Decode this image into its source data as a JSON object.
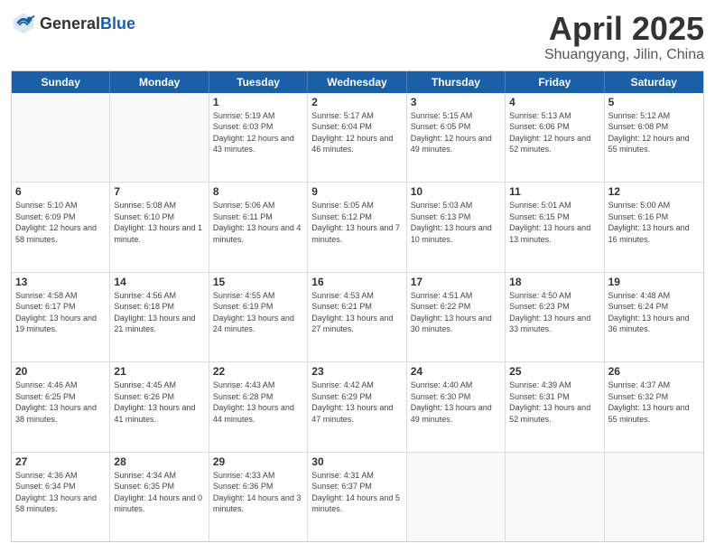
{
  "header": {
    "logo_general": "General",
    "logo_blue": "Blue",
    "title": "April 2025",
    "subtitle": "Shuangyang, Jilin, China"
  },
  "weekdays": [
    "Sunday",
    "Monday",
    "Tuesday",
    "Wednesday",
    "Thursday",
    "Friday",
    "Saturday"
  ],
  "weeks": [
    [
      {
        "day": "",
        "empty": true
      },
      {
        "day": "",
        "empty": true
      },
      {
        "day": "1",
        "sunrise": "Sunrise: 5:19 AM",
        "sunset": "Sunset: 6:03 PM",
        "daylight": "Daylight: 12 hours and 43 minutes."
      },
      {
        "day": "2",
        "sunrise": "Sunrise: 5:17 AM",
        "sunset": "Sunset: 6:04 PM",
        "daylight": "Daylight: 12 hours and 46 minutes."
      },
      {
        "day": "3",
        "sunrise": "Sunrise: 5:15 AM",
        "sunset": "Sunset: 6:05 PM",
        "daylight": "Daylight: 12 hours and 49 minutes."
      },
      {
        "day": "4",
        "sunrise": "Sunrise: 5:13 AM",
        "sunset": "Sunset: 6:06 PM",
        "daylight": "Daylight: 12 hours and 52 minutes."
      },
      {
        "day": "5",
        "sunrise": "Sunrise: 5:12 AM",
        "sunset": "Sunset: 6:08 PM",
        "daylight": "Daylight: 12 hours and 55 minutes."
      }
    ],
    [
      {
        "day": "6",
        "sunrise": "Sunrise: 5:10 AM",
        "sunset": "Sunset: 6:09 PM",
        "daylight": "Daylight: 12 hours and 58 minutes."
      },
      {
        "day": "7",
        "sunrise": "Sunrise: 5:08 AM",
        "sunset": "Sunset: 6:10 PM",
        "daylight": "Daylight: 13 hours and 1 minute."
      },
      {
        "day": "8",
        "sunrise": "Sunrise: 5:06 AM",
        "sunset": "Sunset: 6:11 PM",
        "daylight": "Daylight: 13 hours and 4 minutes."
      },
      {
        "day": "9",
        "sunrise": "Sunrise: 5:05 AM",
        "sunset": "Sunset: 6:12 PM",
        "daylight": "Daylight: 13 hours and 7 minutes."
      },
      {
        "day": "10",
        "sunrise": "Sunrise: 5:03 AM",
        "sunset": "Sunset: 6:13 PM",
        "daylight": "Daylight: 13 hours and 10 minutes."
      },
      {
        "day": "11",
        "sunrise": "Sunrise: 5:01 AM",
        "sunset": "Sunset: 6:15 PM",
        "daylight": "Daylight: 13 hours and 13 minutes."
      },
      {
        "day": "12",
        "sunrise": "Sunrise: 5:00 AM",
        "sunset": "Sunset: 6:16 PM",
        "daylight": "Daylight: 13 hours and 16 minutes."
      }
    ],
    [
      {
        "day": "13",
        "sunrise": "Sunrise: 4:58 AM",
        "sunset": "Sunset: 6:17 PM",
        "daylight": "Daylight: 13 hours and 19 minutes."
      },
      {
        "day": "14",
        "sunrise": "Sunrise: 4:56 AM",
        "sunset": "Sunset: 6:18 PM",
        "daylight": "Daylight: 13 hours and 21 minutes."
      },
      {
        "day": "15",
        "sunrise": "Sunrise: 4:55 AM",
        "sunset": "Sunset: 6:19 PM",
        "daylight": "Daylight: 13 hours and 24 minutes."
      },
      {
        "day": "16",
        "sunrise": "Sunrise: 4:53 AM",
        "sunset": "Sunset: 6:21 PM",
        "daylight": "Daylight: 13 hours and 27 minutes."
      },
      {
        "day": "17",
        "sunrise": "Sunrise: 4:51 AM",
        "sunset": "Sunset: 6:22 PM",
        "daylight": "Daylight: 13 hours and 30 minutes."
      },
      {
        "day": "18",
        "sunrise": "Sunrise: 4:50 AM",
        "sunset": "Sunset: 6:23 PM",
        "daylight": "Daylight: 13 hours and 33 minutes."
      },
      {
        "day": "19",
        "sunrise": "Sunrise: 4:48 AM",
        "sunset": "Sunset: 6:24 PM",
        "daylight": "Daylight: 13 hours and 36 minutes."
      }
    ],
    [
      {
        "day": "20",
        "sunrise": "Sunrise: 4:46 AM",
        "sunset": "Sunset: 6:25 PM",
        "daylight": "Daylight: 13 hours and 38 minutes."
      },
      {
        "day": "21",
        "sunrise": "Sunrise: 4:45 AM",
        "sunset": "Sunset: 6:26 PM",
        "daylight": "Daylight: 13 hours and 41 minutes."
      },
      {
        "day": "22",
        "sunrise": "Sunrise: 4:43 AM",
        "sunset": "Sunset: 6:28 PM",
        "daylight": "Daylight: 13 hours and 44 minutes."
      },
      {
        "day": "23",
        "sunrise": "Sunrise: 4:42 AM",
        "sunset": "Sunset: 6:29 PM",
        "daylight": "Daylight: 13 hours and 47 minutes."
      },
      {
        "day": "24",
        "sunrise": "Sunrise: 4:40 AM",
        "sunset": "Sunset: 6:30 PM",
        "daylight": "Daylight: 13 hours and 49 minutes."
      },
      {
        "day": "25",
        "sunrise": "Sunrise: 4:39 AM",
        "sunset": "Sunset: 6:31 PM",
        "daylight": "Daylight: 13 hours and 52 minutes."
      },
      {
        "day": "26",
        "sunrise": "Sunrise: 4:37 AM",
        "sunset": "Sunset: 6:32 PM",
        "daylight": "Daylight: 13 hours and 55 minutes."
      }
    ],
    [
      {
        "day": "27",
        "sunrise": "Sunrise: 4:36 AM",
        "sunset": "Sunset: 6:34 PM",
        "daylight": "Daylight: 13 hours and 58 minutes."
      },
      {
        "day": "28",
        "sunrise": "Sunrise: 4:34 AM",
        "sunset": "Sunset: 6:35 PM",
        "daylight": "Daylight: 14 hours and 0 minutes."
      },
      {
        "day": "29",
        "sunrise": "Sunrise: 4:33 AM",
        "sunset": "Sunset: 6:36 PM",
        "daylight": "Daylight: 14 hours and 3 minutes."
      },
      {
        "day": "30",
        "sunrise": "Sunrise: 4:31 AM",
        "sunset": "Sunset: 6:37 PM",
        "daylight": "Daylight: 14 hours and 5 minutes."
      },
      {
        "day": "",
        "empty": true
      },
      {
        "day": "",
        "empty": true
      },
      {
        "day": "",
        "empty": true
      }
    ]
  ]
}
